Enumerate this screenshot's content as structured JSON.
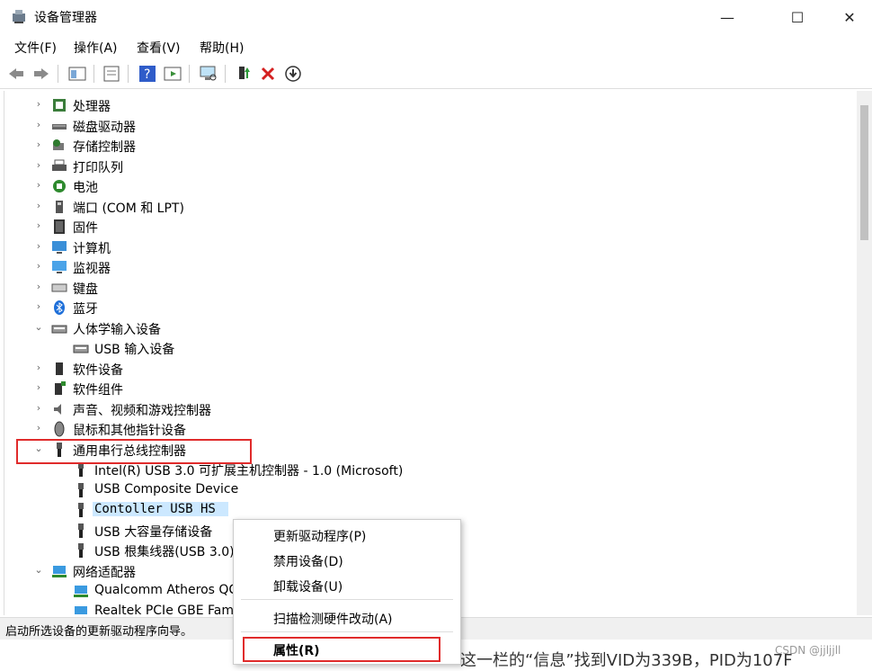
{
  "window": {
    "title": "设备管理器",
    "minimize": "—",
    "maximize": "☐",
    "close": "✕"
  },
  "menubar": [
    "文件(F)",
    "操作(A)",
    "查看(V)",
    "帮助(H)"
  ],
  "tree": [
    {
      "label": "处理器",
      "chev": "›",
      "icon": "cpu-icon"
    },
    {
      "label": "磁盘驱动器",
      "chev": "›",
      "icon": "disk-icon"
    },
    {
      "label": "存储控制器",
      "chev": "›",
      "icon": "storage-icon"
    },
    {
      "label": "打印队列",
      "chev": "›",
      "icon": "printer-icon"
    },
    {
      "label": "电池",
      "chev": "›",
      "icon": "battery-icon"
    },
    {
      "label": "端口 (COM 和 LPT)",
      "chev": "›",
      "icon": "port-icon"
    },
    {
      "label": "固件",
      "chev": "›",
      "icon": "firmware-icon"
    },
    {
      "label": "计算机",
      "chev": "›",
      "icon": "computer-icon"
    },
    {
      "label": "监视器",
      "chev": "›",
      "icon": "monitor-icon"
    },
    {
      "label": "键盘",
      "chev": "›",
      "icon": "keyboard-icon"
    },
    {
      "label": "蓝牙",
      "chev": "›",
      "icon": "bluetooth-icon"
    },
    {
      "label": "人体学输入设备",
      "chev": "⌄",
      "icon": "hid-icon"
    },
    {
      "label": "USB 输入设备",
      "child": true,
      "icon": "hid-icon"
    },
    {
      "label": "软件设备",
      "chev": "›",
      "icon": "software-device-icon"
    },
    {
      "label": "软件组件",
      "chev": "›",
      "icon": "software-component-icon"
    },
    {
      "label": "声音、视频和游戏控制器",
      "chev": "›",
      "icon": "sound-icon"
    },
    {
      "label": "鼠标和其他指针设备",
      "chev": "›",
      "icon": "mouse-icon"
    },
    {
      "label": "通用串行总线控制器",
      "chev": "⌄",
      "icon": "usb-icon"
    },
    {
      "label": "Intel(R) USB 3.0 可扩展主机控制器 - 1.0 (Microsoft)",
      "child": true,
      "icon": "usb-icon"
    },
    {
      "label": "USB Composite Device",
      "child": true,
      "icon": "usb-icon"
    },
    {
      "label": "Contoller USB HS",
      "child": true,
      "icon": "usb-icon",
      "selected": true
    },
    {
      "label": "USB 大容量存储设备",
      "child": true,
      "icon": "usb-icon"
    },
    {
      "label": "USB 根集线器(USB 3.0)",
      "child": true,
      "icon": "usb-icon"
    },
    {
      "label": "网络适配器",
      "chev": "⌄",
      "icon": "network-icon"
    },
    {
      "label": "Qualcomm Atheros QCA9377",
      "child": true,
      "icon": "network-icon"
    },
    {
      "label": "Realtek PCIe GBE Family",
      "child": true,
      "icon": "network-icon"
    }
  ],
  "status": "启动所选设备的更新驱动程序向导。",
  "context_menu": [
    "更新驱动程序(P)",
    "禁用设备(D)",
    "卸载设备(U)",
    "扫描检测硬件改动(A)",
    "属性(R)"
  ],
  "background_text": "这一栏的“信息”找到VID为339B，PID为107F",
  "watermark": "CSDN @jjljjll",
  "colors": {
    "selection": "#cce8ff",
    "annotation_red": "#e02b2b"
  }
}
